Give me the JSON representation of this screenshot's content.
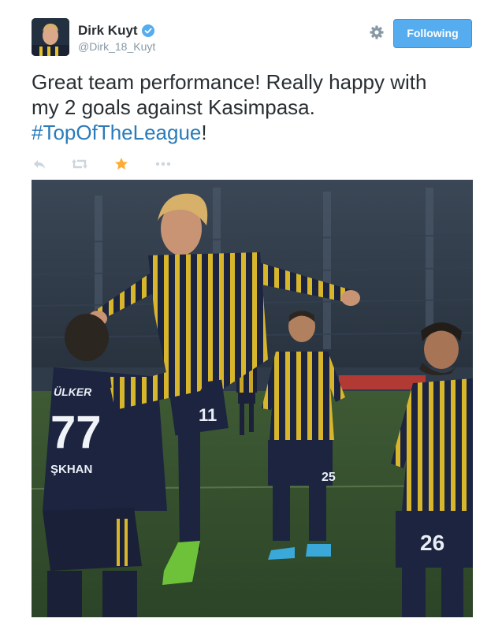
{
  "author": {
    "name": "Dirk Kuyt",
    "handle": "@Dirk_18_Kuyt",
    "verified": true
  },
  "follow_button": {
    "label": "Following"
  },
  "tweet": {
    "text_line1": "Great team performance! Really happy with",
    "text_line2": "my 2 goals against Kasimpasa.",
    "hashtag": "#TopOfTheLeague",
    "text_end": "!"
  },
  "actions": [
    {
      "icon": "reply-icon"
    },
    {
      "icon": "retweet-icon"
    },
    {
      "icon": "favorite-star-icon",
      "active": true
    },
    {
      "icon": "more-icon"
    }
  ],
  "photo": {
    "jersey_texts": {
      "player_left_name": "ÜLKER",
      "player_left_number": "77",
      "player_left_surname": "ŞKHAN",
      "player_jumping_number": "11",
      "player_right_number": "26",
      "player_mid_number": "25"
    }
  },
  "colors": {
    "accent": "#55acee",
    "hashtag": "#2b7bb9",
    "favorite": "#ffac33",
    "action_gray": "#ccd6dd",
    "handle_gray": "#8899a6"
  }
}
